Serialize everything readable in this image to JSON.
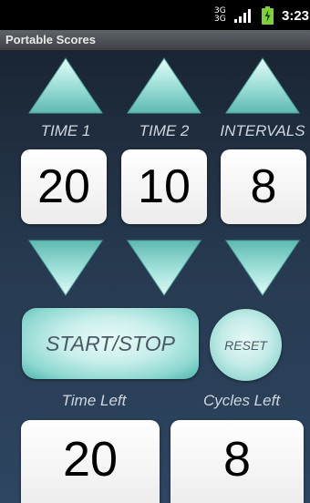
{
  "status_bar": {
    "network_top": "3G",
    "network_bottom": "3G",
    "time": "3:23",
    "icons": [
      "network-type-icon",
      "signal-icon",
      "battery-charging-icon"
    ]
  },
  "title_bar": {
    "title": "Portable Scores"
  },
  "controls": {
    "columns": [
      {
        "label": "TIME 1",
        "value": "20"
      },
      {
        "label": "TIME 2",
        "value": "10"
      },
      {
        "label": "INTERVALS",
        "value": "8"
      }
    ],
    "increment_icon": "triangle-up-icon",
    "decrement_icon": "triangle-down-icon"
  },
  "actions": {
    "start_stop_label": "START/STOP",
    "reset_label": "RESET"
  },
  "summary": {
    "time_left_label": "Time Left",
    "time_left_value": "20",
    "cycles_left_label": "Cycles Left",
    "cycles_left_value": "8"
  },
  "colors": {
    "background_top": "#1a2533",
    "background_bottom": "#2e4662",
    "accent_teal": "#8ed8d1",
    "label_text": "#d0d6dd"
  }
}
